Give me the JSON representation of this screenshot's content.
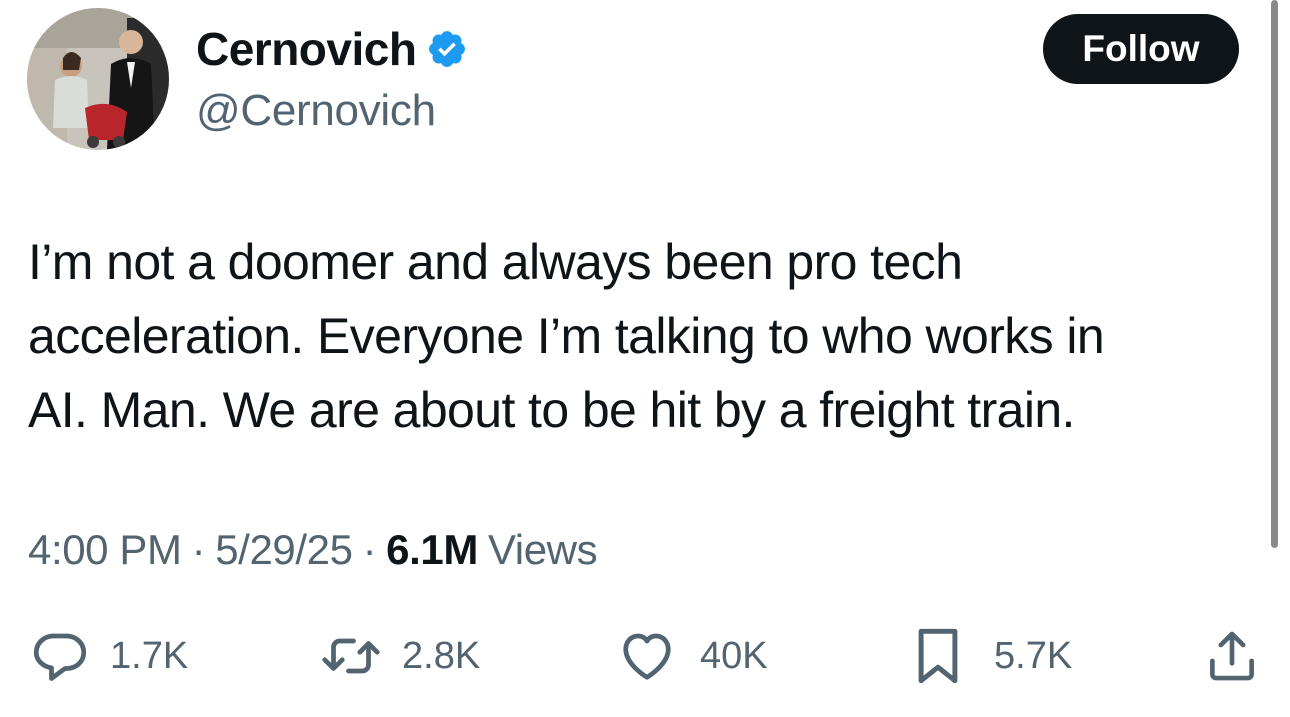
{
  "author": {
    "display_name": "Cernovich",
    "handle": "@Cernovich",
    "verified": true
  },
  "follow_label": "Follow",
  "tweet": {
    "text": "I’m not a doomer and always been pro tech\nacceleration. Everyone I’m talking to who works in\nAI. Man. We are about to be hit by a freight train."
  },
  "meta": {
    "time": "4:00 PM",
    "separator": "·",
    "date": "5/29/25",
    "views_count": "6.1M",
    "views_label": "Views"
  },
  "actions": {
    "replies": "1.7K",
    "reposts": "2.8K",
    "likes": "40K",
    "bookmarks": "5.7K"
  },
  "colors": {
    "text_primary": "#0f1419",
    "text_secondary": "#536471",
    "verified_blue": "#1d9bf0",
    "follow_button_bg": "#0f1419"
  },
  "icons": {
    "reply": "reply-icon",
    "repost": "repost-icon",
    "like": "heart-icon",
    "bookmark": "bookmark-icon",
    "share": "share-icon",
    "verified": "verified-badge-icon"
  }
}
